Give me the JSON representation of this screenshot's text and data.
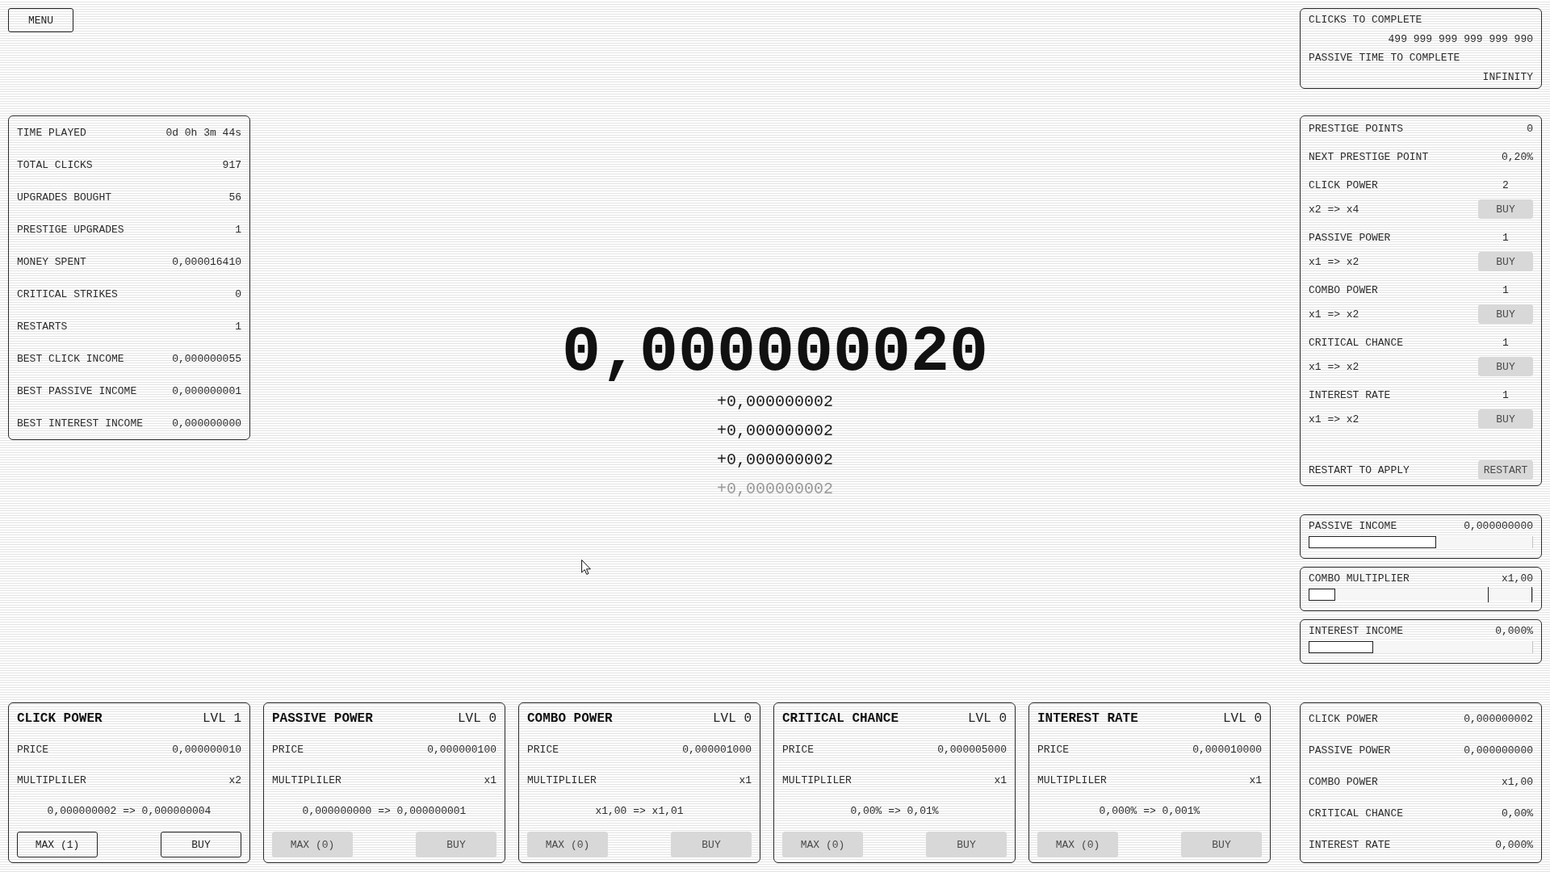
{
  "menu_button": "MENU",
  "stats": [
    {
      "label": "TIME PLAYED",
      "value": "0d 0h 3m 44s"
    },
    {
      "label": "TOTAL CLICKS",
      "value": "917"
    },
    {
      "label": "UPGRADES BOUGHT",
      "value": "56"
    },
    {
      "label": "PRESTIGE UPGRADES",
      "value": "1"
    },
    {
      "label": "MONEY SPENT",
      "value": "0,000016410"
    },
    {
      "label": "CRITICAL STRIKES",
      "value": "0"
    },
    {
      "label": "RESTARTS",
      "value": "1"
    },
    {
      "label": "BEST CLICK INCOME",
      "value": "0,000000055"
    },
    {
      "label": "BEST PASSIVE INCOME",
      "value": "0,000000001"
    },
    {
      "label": "BEST INTEREST INCOME",
      "value": "0,000000000"
    }
  ],
  "money": {
    "amount": "0,000000020",
    "gains": [
      {
        "text": "+0,000000002",
        "faded": false
      },
      {
        "text": "+0,000000002",
        "faded": false
      },
      {
        "text": "+0,000000002",
        "faded": false
      },
      {
        "text": "+0,000000002",
        "faded": true
      }
    ]
  },
  "completion": [
    {
      "label": "CLICKS TO COMPLETE",
      "value": "499 999 999 999 999 990"
    },
    {
      "label": "PASSIVE TIME TO COMPLETE",
      "value": "INFINITY"
    }
  ],
  "prestige": {
    "summary": [
      {
        "label": "PRESTIGE POINTS",
        "value": "0"
      },
      {
        "label": "NEXT PRESTIGE POINT",
        "value": "0,20%"
      }
    ],
    "upgrades": [
      {
        "name": "CLICK POWER",
        "count": "2",
        "change": "x2 => x4",
        "button": {
          "label": "BUY",
          "disabled": true
        }
      },
      {
        "name": "PASSIVE POWER",
        "count": "1",
        "change": "x1 => x2",
        "button": {
          "label": "BUY",
          "disabled": true
        }
      },
      {
        "name": "COMBO POWER",
        "count": "1",
        "change": "x1 => x2",
        "button": {
          "label": "BUY",
          "disabled": true
        }
      },
      {
        "name": "CRITICAL CHANCE",
        "count": "1",
        "change": "x1 => x2",
        "button": {
          "label": "BUY",
          "disabled": true
        }
      },
      {
        "name": "INTEREST RATE",
        "count": "1",
        "change": "x1 => x2",
        "button": {
          "label": "BUY",
          "disabled": true
        }
      }
    ],
    "restart": {
      "label": "RESTART TO APPLY",
      "button": {
        "label": "RESTART",
        "disabled": true
      }
    }
  },
  "meters": [
    {
      "kind": "bar",
      "label": "PASSIVE INCOME",
      "value": "0,000000000",
      "level": 0.57
    },
    {
      "kind": "combo",
      "label": "COMBO MULTIPLIER",
      "value": "x1,00",
      "level": 0.12
    },
    {
      "kind": "bar",
      "label": "INTEREST INCOME",
      "value": "0,000%",
      "level": 0.29
    }
  ],
  "cards": [
    {
      "name": "CLICK POWER",
      "lvl": "LVL 1",
      "price_label": "PRICE",
      "price": "0,000000010",
      "multiplier_label": "MULTIPLILER",
      "multiplier": "x2",
      "change": "0,000000002 => 0,000000004",
      "max_button": {
        "label": "MAX (1)",
        "disabled": false
      },
      "buy_button": {
        "label": "BUY",
        "disabled": false
      }
    },
    {
      "name": "PASSIVE POWER",
      "lvl": "LVL 0",
      "price_label": "PRICE",
      "price": "0,000000100",
      "multiplier_label": "MULTIPLILER",
      "multiplier": "x1",
      "change": "0,000000000 => 0,000000001",
      "max_button": {
        "label": "MAX (0)",
        "disabled": true
      },
      "buy_button": {
        "label": "BUY",
        "disabled": true
      }
    },
    {
      "name": "COMBO POWER",
      "lvl": "LVL 0",
      "price_label": "PRICE",
      "price": "0,000001000",
      "multiplier_label": "MULTIPLILER",
      "multiplier": "x1",
      "change": "x1,00 => x1,01",
      "max_button": {
        "label": "MAX (0)",
        "disabled": true
      },
      "buy_button": {
        "label": "BUY",
        "disabled": true
      }
    },
    {
      "name": "CRITICAL CHANCE",
      "lvl": "LVL 0",
      "price_label": "PRICE",
      "price": "0,000005000",
      "multiplier_label": "MULTIPLILER",
      "multiplier": "x1",
      "change": "0,00% => 0,01%",
      "max_button": {
        "label": "MAX (0)",
        "disabled": true
      },
      "buy_button": {
        "label": "BUY",
        "disabled": true
      }
    },
    {
      "name": "INTEREST RATE",
      "lvl": "LVL 0",
      "price_label": "PRICE",
      "price": "0,000010000",
      "multiplier_label": "MULTIPLILER",
      "multiplier": "x1",
      "change": "0,000% => 0,001%",
      "max_button": {
        "label": "MAX (0)",
        "disabled": true
      },
      "buy_button": {
        "label": "BUY",
        "disabled": true
      }
    }
  ],
  "totals": [
    {
      "label": "CLICK POWER",
      "value": "0,000000002"
    },
    {
      "label": "PASSIVE POWER",
      "value": "0,000000000"
    },
    {
      "label": "COMBO POWER",
      "value": "x1,00"
    },
    {
      "label": "CRITICAL CHANCE",
      "value": "0,00%"
    },
    {
      "label": "INTEREST RATE",
      "value": "0,000%"
    }
  ]
}
